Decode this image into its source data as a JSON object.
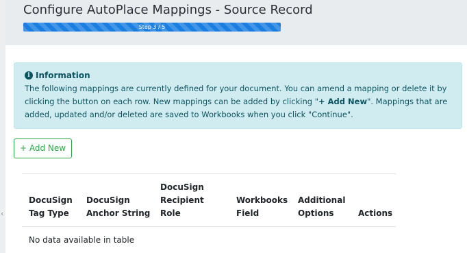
{
  "header": {
    "title": "Configure AutoPlace Mappings - Source Record",
    "progress": {
      "label": "Step 3 / 5",
      "fraction": 1.0,
      "color": "#1a7fe0"
    }
  },
  "info": {
    "title": "Information",
    "icon": "info-circle-icon",
    "text_before": "The following mappings are currently defined for your document. You can amend a mapping or delete it by clicking the button on each row. New mappings can be added by clicking \"",
    "text_bold": "+ Add New",
    "text_after": "\". Mappings that are added, updated and/or deleted are saved to Workbooks when you click \"Continue\"."
  },
  "actions": {
    "add_new_label": "+ Add New"
  },
  "table": {
    "columns": [
      {
        "line1": "DocuSign",
        "line2": "Tag Type"
      },
      {
        "line1": "DocuSign",
        "line2": "Anchor String"
      },
      {
        "line1": "DocuSign",
        "line2": "Recipient Role"
      },
      {
        "line1": "Workbooks",
        "line2": "Field"
      },
      {
        "line1": "Additional",
        "line2": "Options"
      },
      {
        "line1": "",
        "line2": "Actions"
      }
    ],
    "empty_message": "No data available in table"
  },
  "colors": {
    "info_bg": "#d1ecf1",
    "info_text": "#0c5460",
    "success": "#28a745",
    "progress": "#1a7fe0"
  },
  "sidebar": {
    "collapse_icon": "chevron-left-icon",
    "collapse_glyph": "‹"
  }
}
